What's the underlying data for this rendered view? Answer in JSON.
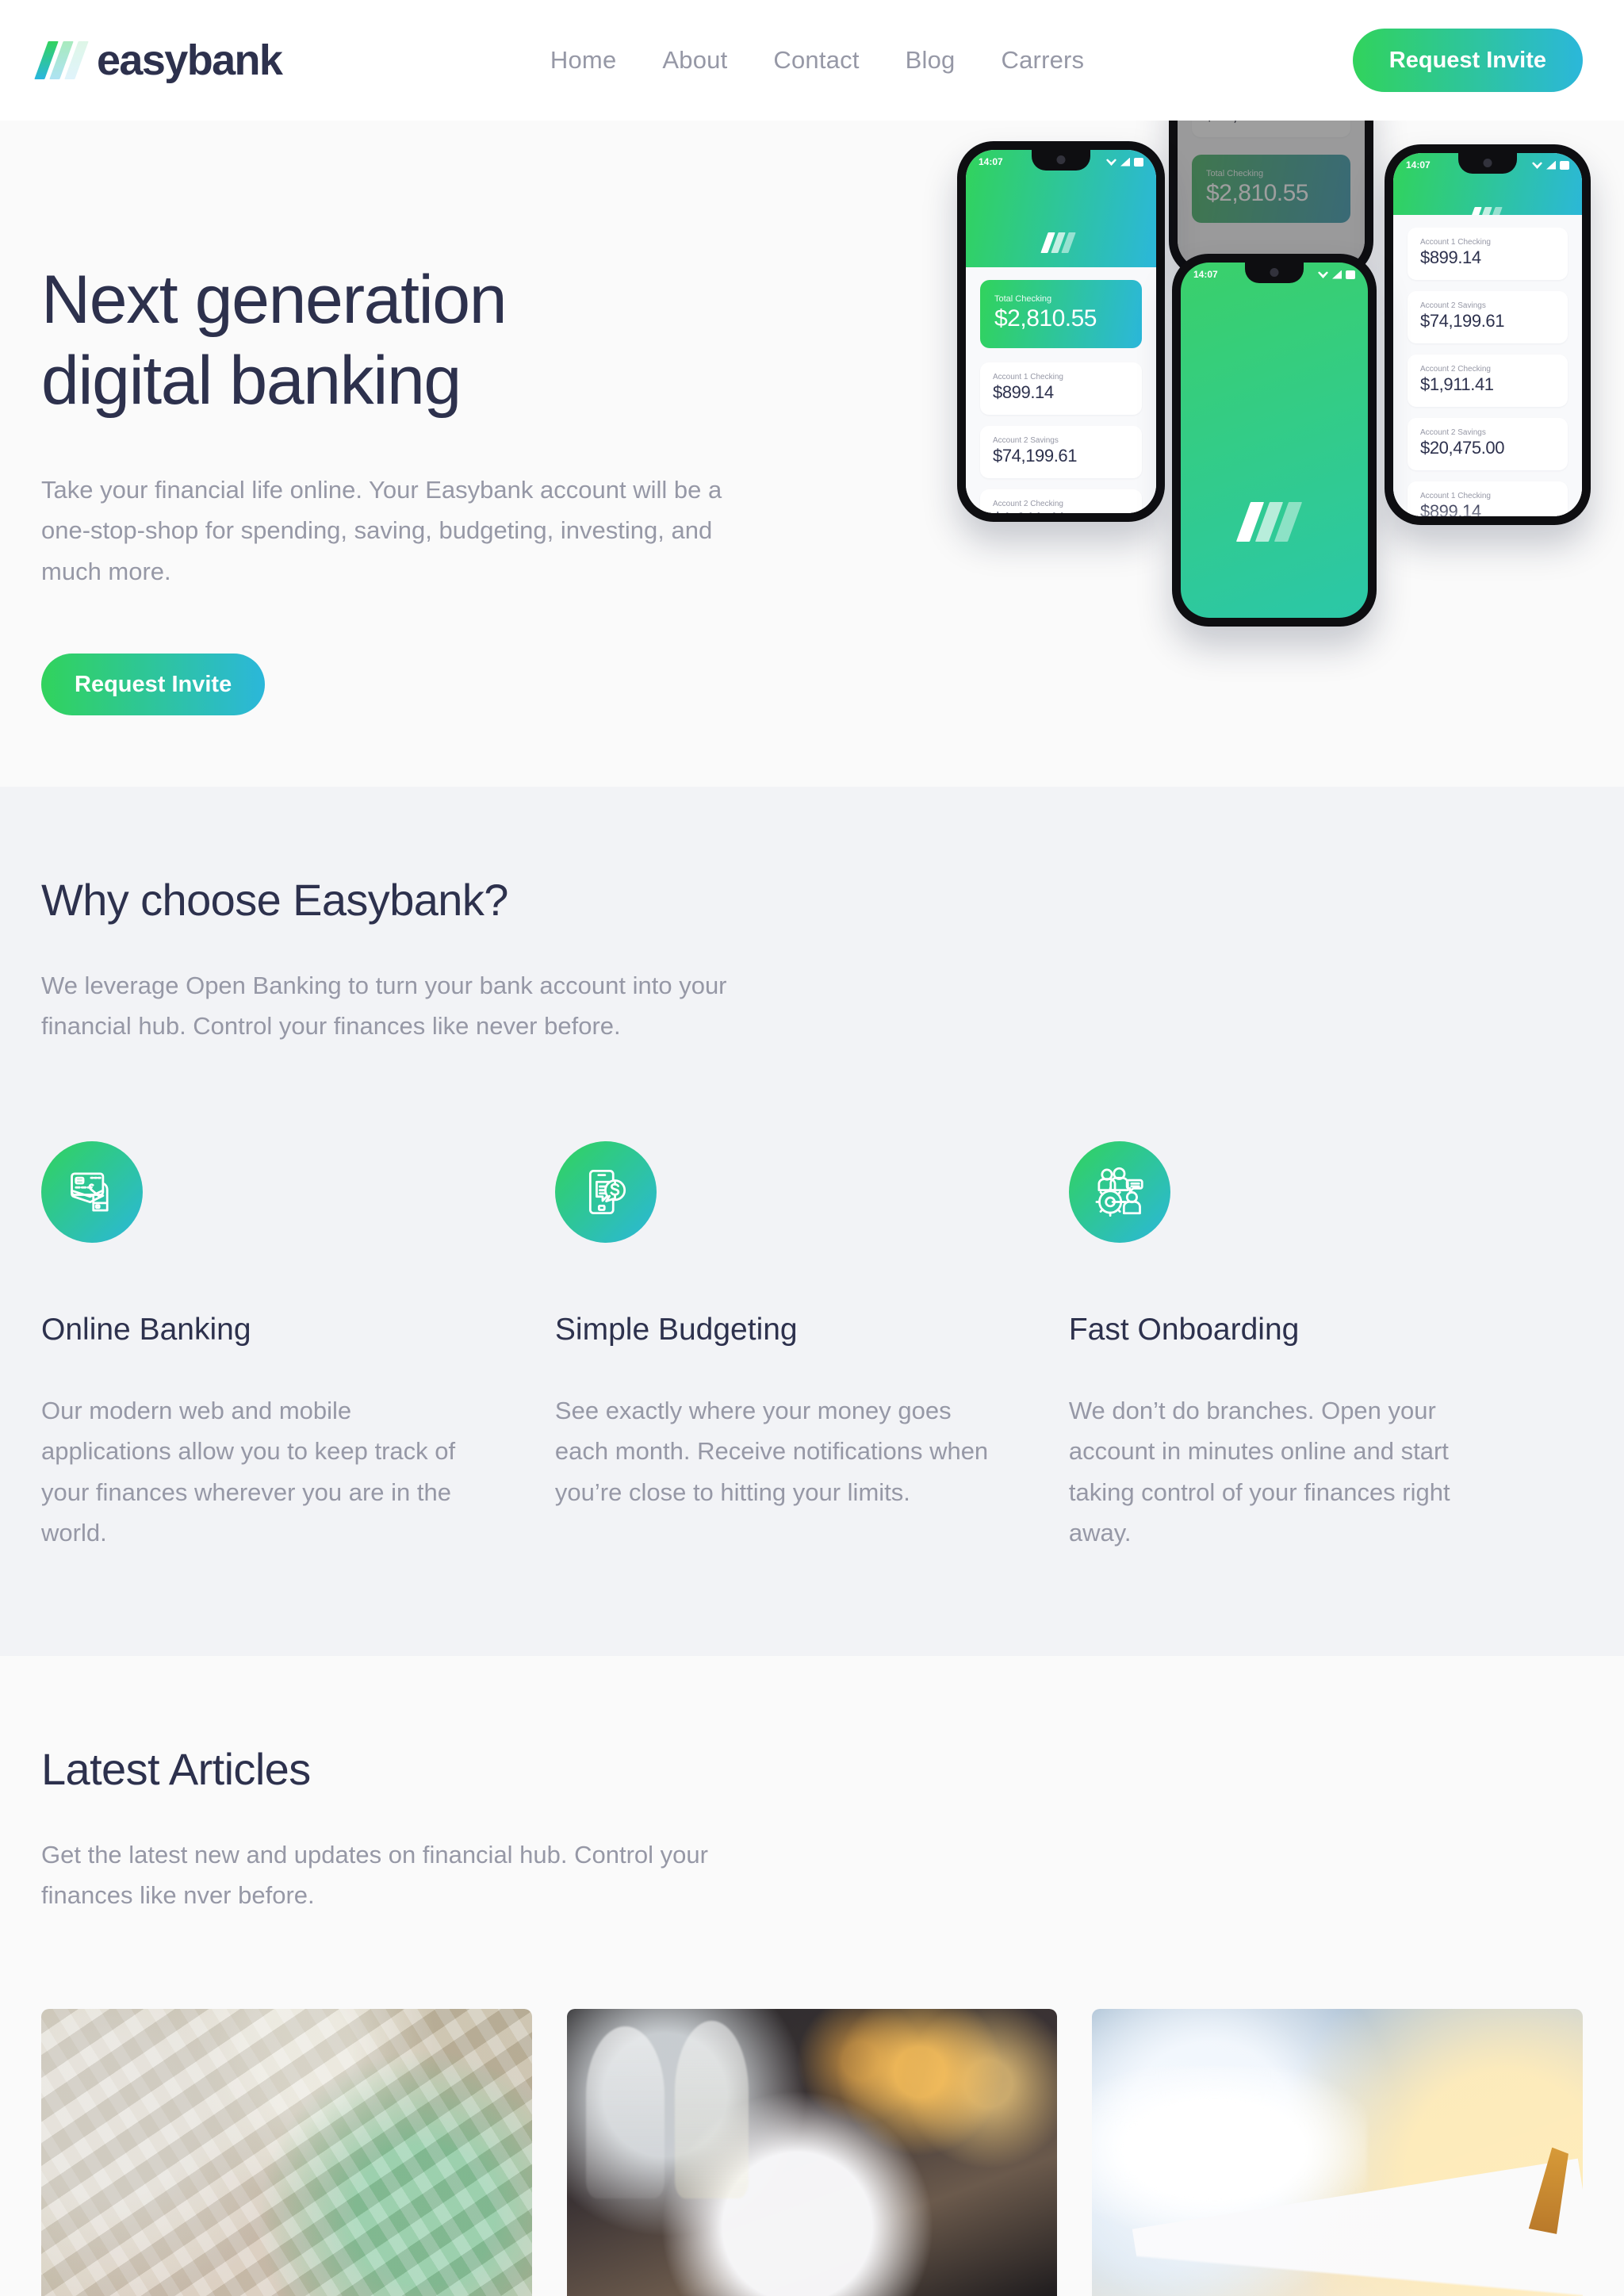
{
  "brand": {
    "name": "easybank",
    "logo_icon": "easybank-slash-logo",
    "accent_green": "#31d35c",
    "accent_cyan": "#2bb7da",
    "navy": "#2d314d",
    "grey": "#9698a6"
  },
  "header": {
    "nav": [
      {
        "label": "Home"
      },
      {
        "label": "About"
      },
      {
        "label": "Contact"
      },
      {
        "label": "Blog"
      },
      {
        "label": "Carrers"
      }
    ],
    "cta_label": "Request Invite"
  },
  "hero": {
    "title_line1": "Next generation",
    "title_line2": "digital banking",
    "body": "Take your financial life online. Your Easybank account will be a one-stop-shop for spending, saving, budgeting, investing, and much more.",
    "cta_label": "Request Invite",
    "phone_mockups": {
      "status_time": "14:07",
      "status_icons": [
        "wifi-icon",
        "signal-icon",
        "battery-icon"
      ],
      "fab_icon": "plus-icon",
      "total_label": "Total Checking",
      "total_amount": "$2,810.55",
      "accounts": [
        {
          "label": "Account 1 Checking",
          "amount": "$899.14"
        },
        {
          "label": "Account 2 Savings",
          "amount": "$74,199.61"
        },
        {
          "label": "Account 2 Checking",
          "amount": "$1,911.41"
        },
        {
          "label": "Account 2 Savings",
          "amount": "$20,475.00"
        },
        {
          "label": "Account 1 Checking",
          "amount": "$899.14"
        }
      ]
    }
  },
  "why": {
    "title": "Why choose Easybank?",
    "body": "We leverage Open Banking to turn your bank account into your financial hub. Control your finances like never before.",
    "features": [
      {
        "icon": "hand-holding-credit-card-icon",
        "title": "Online Banking",
        "body": "Our modern web and mobile applications allow you to keep track of your finances wherever you are in the world."
      },
      {
        "icon": "phone-money-document-icon",
        "title": "Simple Budgeting",
        "body": "See exactly where your money goes each month. Receive notifications when you’re close to hitting your limits."
      },
      {
        "icon": "people-gear-onboarding-icon",
        "title": "Fast Onboarding",
        "body": "We don’t do branches. Open your account in minutes online and start taking control of your finances right away."
      }
    ]
  },
  "articles": {
    "title": "Latest Articles",
    "body": "Get the latest new and updates on financial hub. Control your finances like nver before.",
    "cards": [
      {
        "image": "banknotes-photo"
      },
      {
        "image": "restaurant-dining-photo"
      },
      {
        "image": "airplane-wing-sky-photo"
      }
    ]
  }
}
